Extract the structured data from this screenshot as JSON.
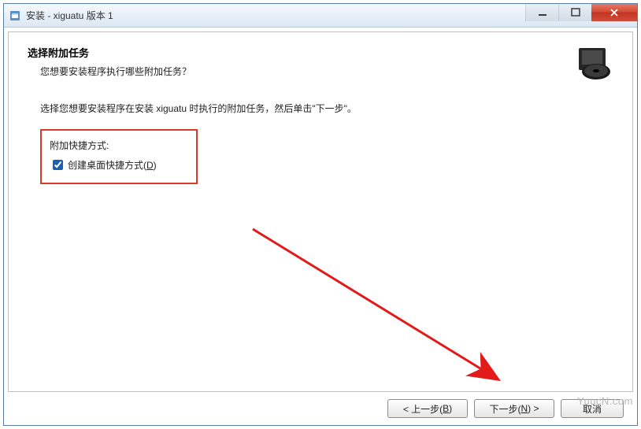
{
  "titlebar": {
    "text": "安装 - xiguatu 版本 1"
  },
  "header": {
    "heading": "选择附加任务",
    "subheading": "您想要安装程序执行哪些附加任务？"
  },
  "instruction": "选择您想要安装程序在安装 xiguatu 时执行的附加任务，然后单击\"下一步\"。",
  "group": {
    "label": "附加快捷方式:",
    "checkbox_label_pre": "创建桌面快捷方式(",
    "checkbox_hotkey": "D",
    "checkbox_label_post": ")",
    "checked": true
  },
  "buttons": {
    "back_pre": "< 上一步(",
    "back_hk": "B",
    "back_post": ")",
    "next_pre": "下一步(",
    "next_hk": "N",
    "next_post": ") >",
    "cancel": "取消"
  },
  "watermark": "YuucN.com"
}
